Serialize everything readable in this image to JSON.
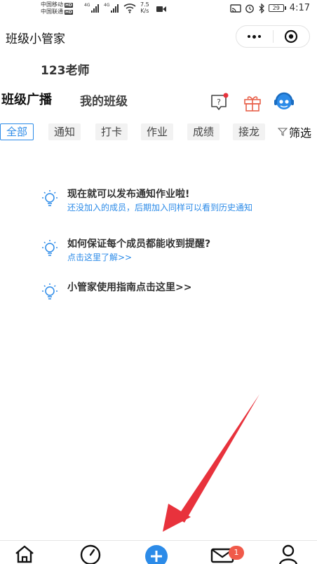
{
  "status_bar": {
    "carrier1": "中国移动",
    "carrier2": "中国联通",
    "hd": "HD",
    "net1": "4G",
    "net2": "4G",
    "speed_value": "7.5",
    "speed_unit": "K/s",
    "battery": "29",
    "time": "4:17"
  },
  "header": {
    "title": "班级小管家"
  },
  "teacher": {
    "name": "123老师"
  },
  "tabs": [
    {
      "label": "班级广播",
      "active": true
    },
    {
      "label": "我的班级",
      "active": false
    }
  ],
  "header_icons": [
    "help-icon",
    "gift-icon",
    "customer-service-icon"
  ],
  "chips": [
    {
      "label": "全部",
      "active": true
    },
    {
      "label": "通知",
      "active": false
    },
    {
      "label": "打卡",
      "active": false
    },
    {
      "label": "作业",
      "active": false
    },
    {
      "label": "成绩",
      "active": false
    },
    {
      "label": "接龙",
      "active": false
    }
  ],
  "filter": {
    "label": "筛选"
  },
  "tips": [
    {
      "title": "现在就可以发布通知作业啦!",
      "subtitle": "还没加入的成员，后期加入同样可以看到历史通知"
    },
    {
      "title": "如何保证每个成员都能收到提醒?",
      "subtitle": "点击这里了解>>"
    },
    {
      "title": "小管家使用指南点击这里>>",
      "subtitle": ""
    }
  ],
  "bottom_nav": {
    "items": [
      "home-icon",
      "dashboard-icon",
      "add-icon",
      "message-icon",
      "profile-icon"
    ],
    "message_badge": "1"
  },
  "colors": {
    "accent": "#2c8be8",
    "badge": "#f05a4a",
    "arrow": "#e8323c",
    "chip_bg": "#f2f2f2"
  }
}
